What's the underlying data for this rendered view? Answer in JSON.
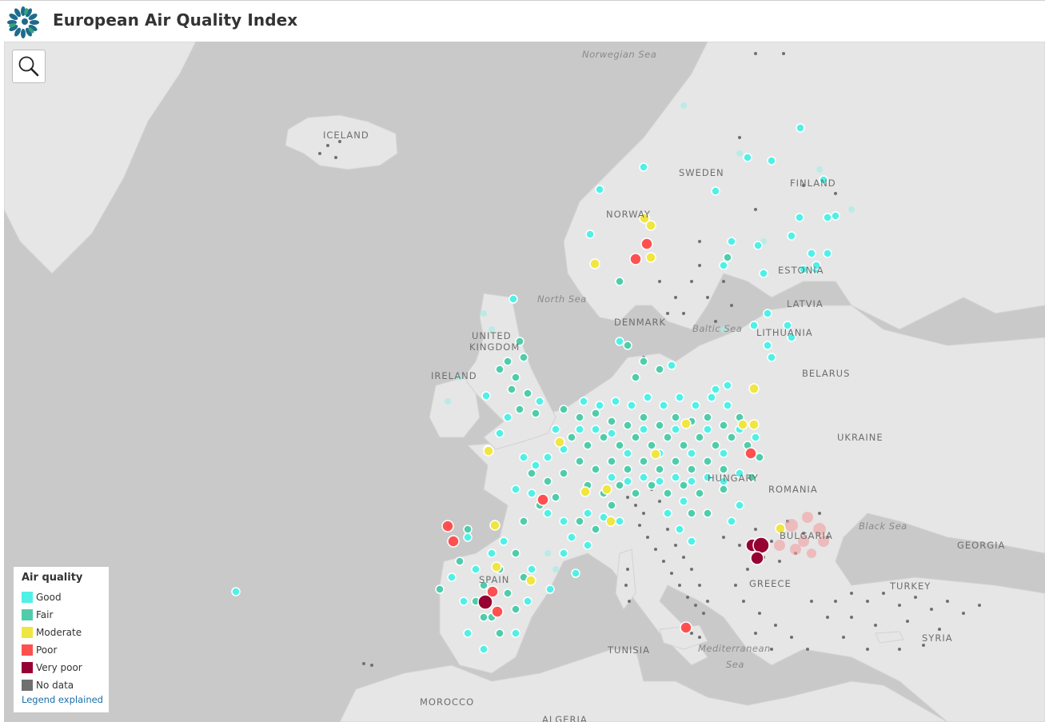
{
  "header": {
    "title": "European Air Quality Index",
    "logo_icon": "eea-logo-icon"
  },
  "toolbar": {
    "search_icon": "search-icon"
  },
  "legend": {
    "title": "Air quality",
    "items": [
      {
        "label": "Good",
        "color": "#50f0e6"
      },
      {
        "label": "Fair",
        "color": "#50ccaa"
      },
      {
        "label": "Moderate",
        "color": "#f0e641"
      },
      {
        "label": "Poor",
        "color": "#ff5050"
      },
      {
        "label": "Very poor",
        "color": "#960032"
      },
      {
        "label": "No data",
        "color": "#707070"
      }
    ],
    "link": "Legend explained"
  },
  "map": {
    "land_color": "#e6e6e6",
    "water_color": "#c9c9c9",
    "labels": {
      "norwegian_sea": "Norwegian Sea",
      "iceland": "ICELAND",
      "sweden": "SWEDEN",
      "finland": "FINLAND",
      "norway": "NORWAY",
      "estonia": "ESTONIA",
      "latvia": "LATVIA",
      "north_sea": "North Sea",
      "denmark": "DENMARK",
      "baltic_sea": "Baltic Sea",
      "lithuania": "LITHUANIA",
      "united_kingdom_1": "UNITED",
      "united_kingdom_2": "KINGDOM",
      "ireland": "IRELAND",
      "belarus": "BELARUS",
      "ukraine": "UKRAINE",
      "hungary": "HUNGARY",
      "romania": "ROMANIA",
      "black_sea": "Black Sea",
      "bulgaria": "BULGARIA",
      "georgia": "GEORGIA",
      "spain": "SPAIN",
      "greece": "GREECE",
      "turkey": "TURKEY",
      "syria": "SYRIA",
      "tunisia": "TUNISIA",
      "mediterranean_1": "Mediterranean",
      "mediterranean_2": "Sea",
      "morocco": "MOROCCO",
      "algeria": "ALGERIA"
    }
  }
}
